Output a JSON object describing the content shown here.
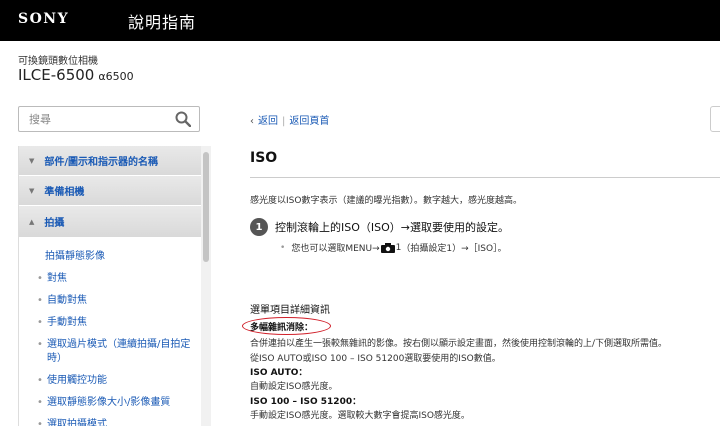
{
  "header": {
    "brand": "SONY",
    "title": "說明指南"
  },
  "product": {
    "subtitle": "可換鏡頭數位相機",
    "model": "ILCE-6500",
    "alpha_model": "α6500"
  },
  "search": {
    "placeholder": "搜尋"
  },
  "sidebar": {
    "categories": [
      {
        "label": "部件/圖示和指示器的名稱",
        "expanded": false
      },
      {
        "label": "準備相機",
        "expanded": false
      },
      {
        "label": "拍攝",
        "expanded": true
      }
    ],
    "sub_items": [
      "拍攝靜態影像",
      "對焦",
      "自動對焦",
      "手動對焦",
      "選取過片模式（連續拍攝/自拍定時）",
      "使用觸控功能",
      "選取靜態影像大小/影像畫質",
      "選取拍攝模式"
    ]
  },
  "nav": {
    "back": "返回",
    "top": "返回頁首"
  },
  "content": {
    "title": "ISO",
    "intro": "感光度以ISO數字表示（建議的曝光指數）。數字越大，感光度越高。",
    "step_number": "1",
    "step_text": "控制滾輪上的ISO（ISO）→選取要使用的設定。",
    "note_prefix": "您也可以選取MENU→",
    "note_icon_index": "1",
    "note_suffix": "（拍攝設定1）→［ISO］。",
    "section_heading": "選單項目詳細資訊",
    "term_nr": "多幅雜訊消除：",
    "desc_nr": "合併連拍以產生一張較無雜訊的影像。按右側以顯示設定畫面，然後使用控制滾輪的上/下側選取所需值。",
    "desc_nr2": "從ISO AUTO或ISO 100 – ISO 51200選取要使用的ISO數值。",
    "term_auto": "ISO AUTO：",
    "desc_auto": "自動設定ISO感光度。",
    "term_range": "ISO 100 – ISO 51200：",
    "desc_range": "手動設定ISO感光度。選取較大數字會提高ISO感光度。"
  },
  "icons": {
    "search": "magnifier-icon",
    "camera": "camera-icon",
    "back": "chevron-left-icon"
  },
  "colors": {
    "header_bg": "#000000",
    "link": "#1a5ab5",
    "highlight_oval": "#d0202a"
  }
}
